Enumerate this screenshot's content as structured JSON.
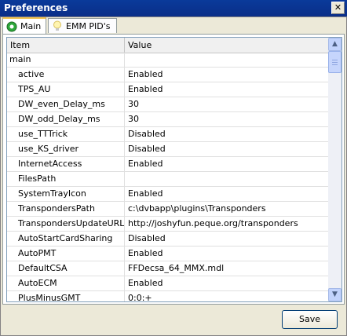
{
  "window": {
    "title": "Preferences",
    "close_glyph": "✕"
  },
  "tabs": [
    {
      "label": "Main",
      "icon": "green-gear-icon",
      "active": true
    },
    {
      "label": "EMM PID's",
      "icon": "lightbulb-icon",
      "active": false
    }
  ],
  "grid": {
    "columns": [
      "Item",
      "Value"
    ],
    "rows": [
      {
        "item": "main",
        "value": ""
      },
      {
        "item": "active",
        "value": "Enabled"
      },
      {
        "item": "TPS_AU",
        "value": "Enabled"
      },
      {
        "item": "DW_even_Delay_ms",
        "value": "30"
      },
      {
        "item": "DW_odd_Delay_ms",
        "value": "30"
      },
      {
        "item": "use_TTTrick",
        "value": "Disabled"
      },
      {
        "item": "use_KS_driver",
        "value": "Disabled"
      },
      {
        "item": "InternetAccess",
        "value": "Enabled"
      },
      {
        "item": "FilesPath",
        "value": ""
      },
      {
        "item": "SystemTrayIcon",
        "value": "Enabled"
      },
      {
        "item": "TranspondersPath",
        "value": "c:\\dvbapp\\plugins\\Transponders"
      },
      {
        "item": "TranspondersUpdateURL",
        "value": "http://joshyfun.peque.org/transponders"
      },
      {
        "item": "AutoStartCardSharing",
        "value": "Disabled"
      },
      {
        "item": "AutoPMT",
        "value": "Enabled"
      },
      {
        "item": "DefaultCSA",
        "value": "FFDecsa_64_MMX.mdl"
      },
      {
        "item": "AutoECM",
        "value": "Enabled"
      },
      {
        "item": "PlusMinusGMT",
        "value": "0:0:+"
      }
    ]
  },
  "footer": {
    "save_label": "Save"
  },
  "colors": {
    "title_bar": "#0a3a9a",
    "window_bg": "#ece9d8",
    "tab_accent": "#f1c34f"
  }
}
